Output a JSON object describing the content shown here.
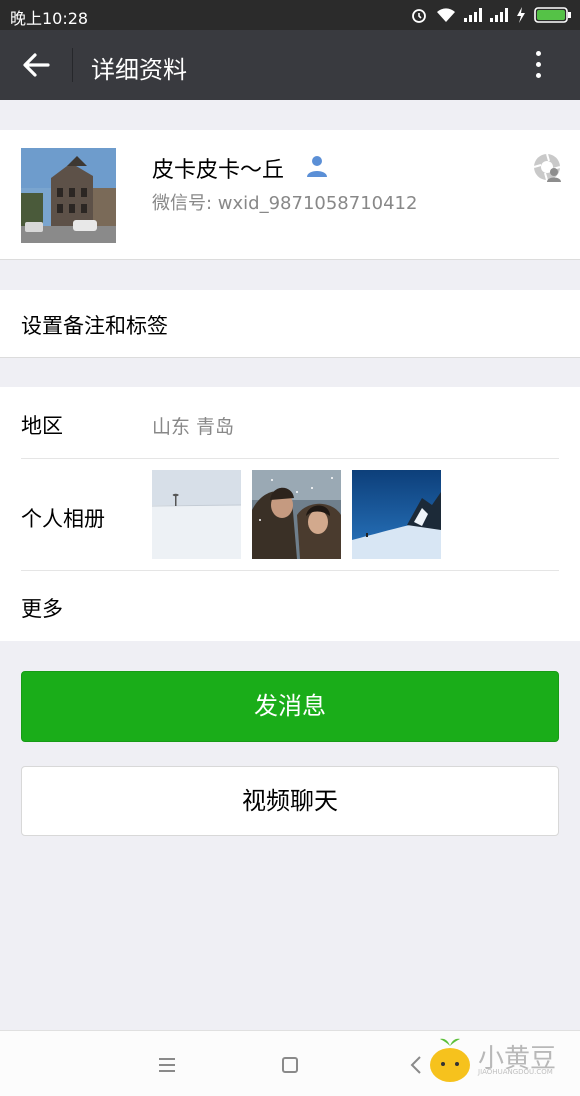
{
  "status_bar": {
    "time": "晚上10:28",
    "icons": [
      "alarm-icon",
      "wifi-icon",
      "signal-icon",
      "signal-icon",
      "charging-icon",
      "battery-icon"
    ]
  },
  "header": {
    "title": "详细资料",
    "back_icon": "back-arrow-icon",
    "menu_icon": "more-vertical-icon",
    "background": "#393a3f"
  },
  "profile": {
    "nickname": "皮卡皮卡～丘",
    "wechat_id": "微信号: wxid_9871058710412",
    "avatar": "street-building-photo",
    "badge_icon": "person-icon",
    "moments_icon": "moments-shutter-icon"
  },
  "remark": {
    "label": "设置备注和标签"
  },
  "info": {
    "region_label": "地区",
    "region_value": "山东  青岛",
    "album_label": "个人相册",
    "album_photos": [
      "snowfield-photo",
      "couple-in-snow-photo",
      "snow-mountain-photo"
    ],
    "more_label": "更多"
  },
  "actions": {
    "send_message": "发消息",
    "video_chat": "视频聊天",
    "accent_color": "#1aad19"
  },
  "nav_bar": {
    "icons": [
      "menu-icon",
      "home-icon",
      "back-icon"
    ]
  },
  "watermark": {
    "text": "小黄豆",
    "subtext": "JIAOHUANGDOU.COM"
  }
}
